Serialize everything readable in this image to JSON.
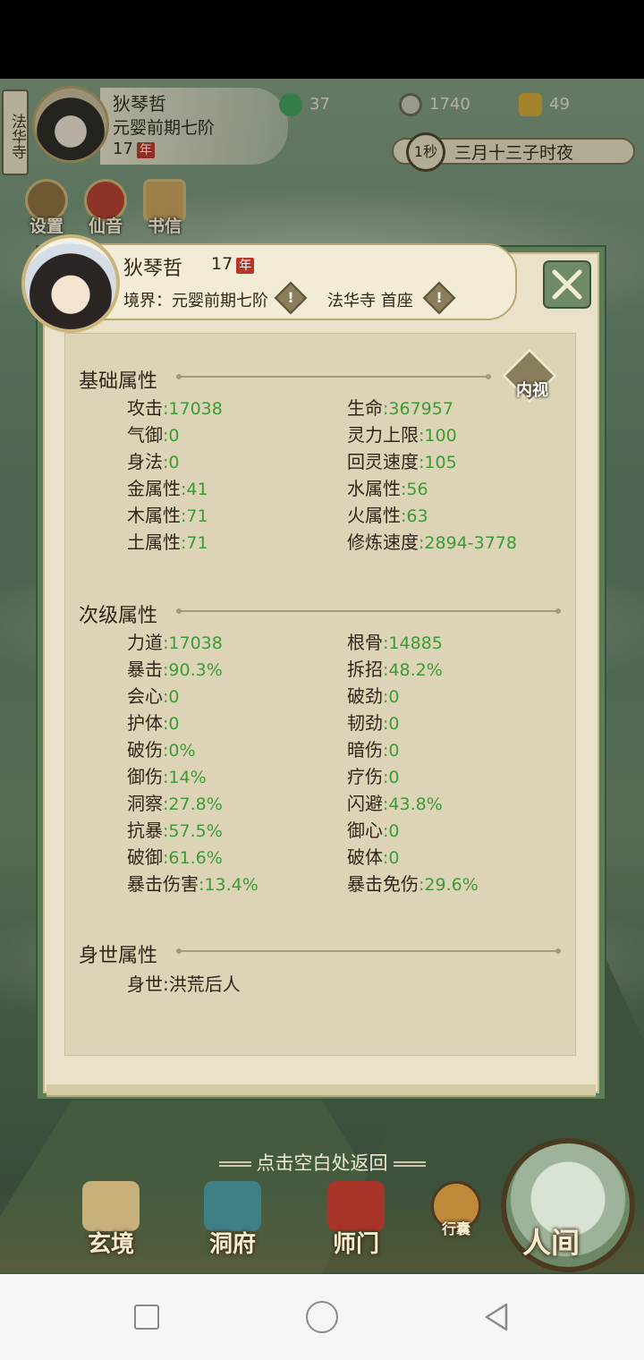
{
  "hud": {
    "sect_tag": "法华寺",
    "name": "狄琴哲",
    "realm": "元婴前期七阶",
    "age": "17",
    "age_unit": "年",
    "resources": [
      {
        "icon": "jade-coil-icon",
        "value": "37"
      },
      {
        "icon": "coin-icon",
        "value": "1740"
      },
      {
        "icon": "gold-ingot-icon",
        "value": "49"
      }
    ],
    "time_speed": "1秒",
    "time_text": "三月十三子时夜",
    "quick": [
      {
        "label": "设置",
        "icon": "settings-icon"
      },
      {
        "label": "仙音",
        "icon": "music-off-icon"
      },
      {
        "label": "书信",
        "icon": "letters-icon"
      }
    ]
  },
  "profile": {
    "name": "狄琴哲",
    "age": "17",
    "age_unit": "年",
    "realm": "境界：元婴前期七阶",
    "sect": "法华寺 首座",
    "warn_mark": "!"
  },
  "inner_view_label": "内视",
  "sections": {
    "basic": {
      "title": "基础属性",
      "left": [
        {
          "k": "攻击",
          "v": "17038"
        },
        {
          "k": "气御",
          "v": "0"
        },
        {
          "k": "身法",
          "v": "0"
        },
        {
          "k": "金属性",
          "v": "41"
        },
        {
          "k": "木属性",
          "v": "71"
        },
        {
          "k": "土属性",
          "v": "71"
        }
      ],
      "right": [
        {
          "k": "生命",
          "v": "367957"
        },
        {
          "k": "灵力上限",
          "v": "100"
        },
        {
          "k": "回灵速度",
          "v": "105"
        },
        {
          "k": "水属性",
          "v": "56"
        },
        {
          "k": "火属性",
          "v": "63"
        },
        {
          "k": "修炼速度",
          "v": "2894-3778"
        }
      ]
    },
    "secondary": {
      "title": "次级属性",
      "left": [
        {
          "k": "力道",
          "v": "17038"
        },
        {
          "k": "暴击",
          "v": "90.3%"
        },
        {
          "k": "会心",
          "v": "0"
        },
        {
          "k": "护体",
          "v": "0"
        },
        {
          "k": "破伤",
          "v": "0%"
        },
        {
          "k": "御伤",
          "v": "14%"
        },
        {
          "k": "洞察",
          "v": "27.8%"
        },
        {
          "k": "抗暴",
          "v": "57.5%"
        },
        {
          "k": "破御",
          "v": "61.6%"
        },
        {
          "k": "暴击伤害",
          "v": "13.4%"
        }
      ],
      "right": [
        {
          "k": "根骨",
          "v": "14885"
        },
        {
          "k": "拆招",
          "v": "48.2%"
        },
        {
          "k": "破劲",
          "v": "0"
        },
        {
          "k": "韧劲",
          "v": "0"
        },
        {
          "k": "暗伤",
          "v": "0"
        },
        {
          "k": "疗伤",
          "v": "0"
        },
        {
          "k": "闪避",
          "v": "43.8%"
        },
        {
          "k": "御心",
          "v": "0"
        },
        {
          "k": "破体",
          "v": "0"
        },
        {
          "k": "暴击免伤",
          "v": "29.6%"
        }
      ]
    },
    "background": {
      "title": "身世属性",
      "items": [
        {
          "k": "身世",
          "v": "洪荒后人"
        }
      ]
    }
  },
  "return_hint": "点击空白处返回",
  "nav": {
    "items": [
      {
        "label": "玄境",
        "icon": "scroll-icon"
      },
      {
        "label": "洞府",
        "icon": "pavilion-icon"
      },
      {
        "label": "师门",
        "icon": "banner-icon"
      },
      {
        "label": "行囊",
        "icon": "bag-icon"
      }
    ],
    "world": {
      "label": "人间",
      "icon": "world-icon"
    }
  },
  "colors": {
    "value_green": "#3d9a36",
    "text_dark": "#2f2618",
    "panel": "#e9e2c8"
  }
}
